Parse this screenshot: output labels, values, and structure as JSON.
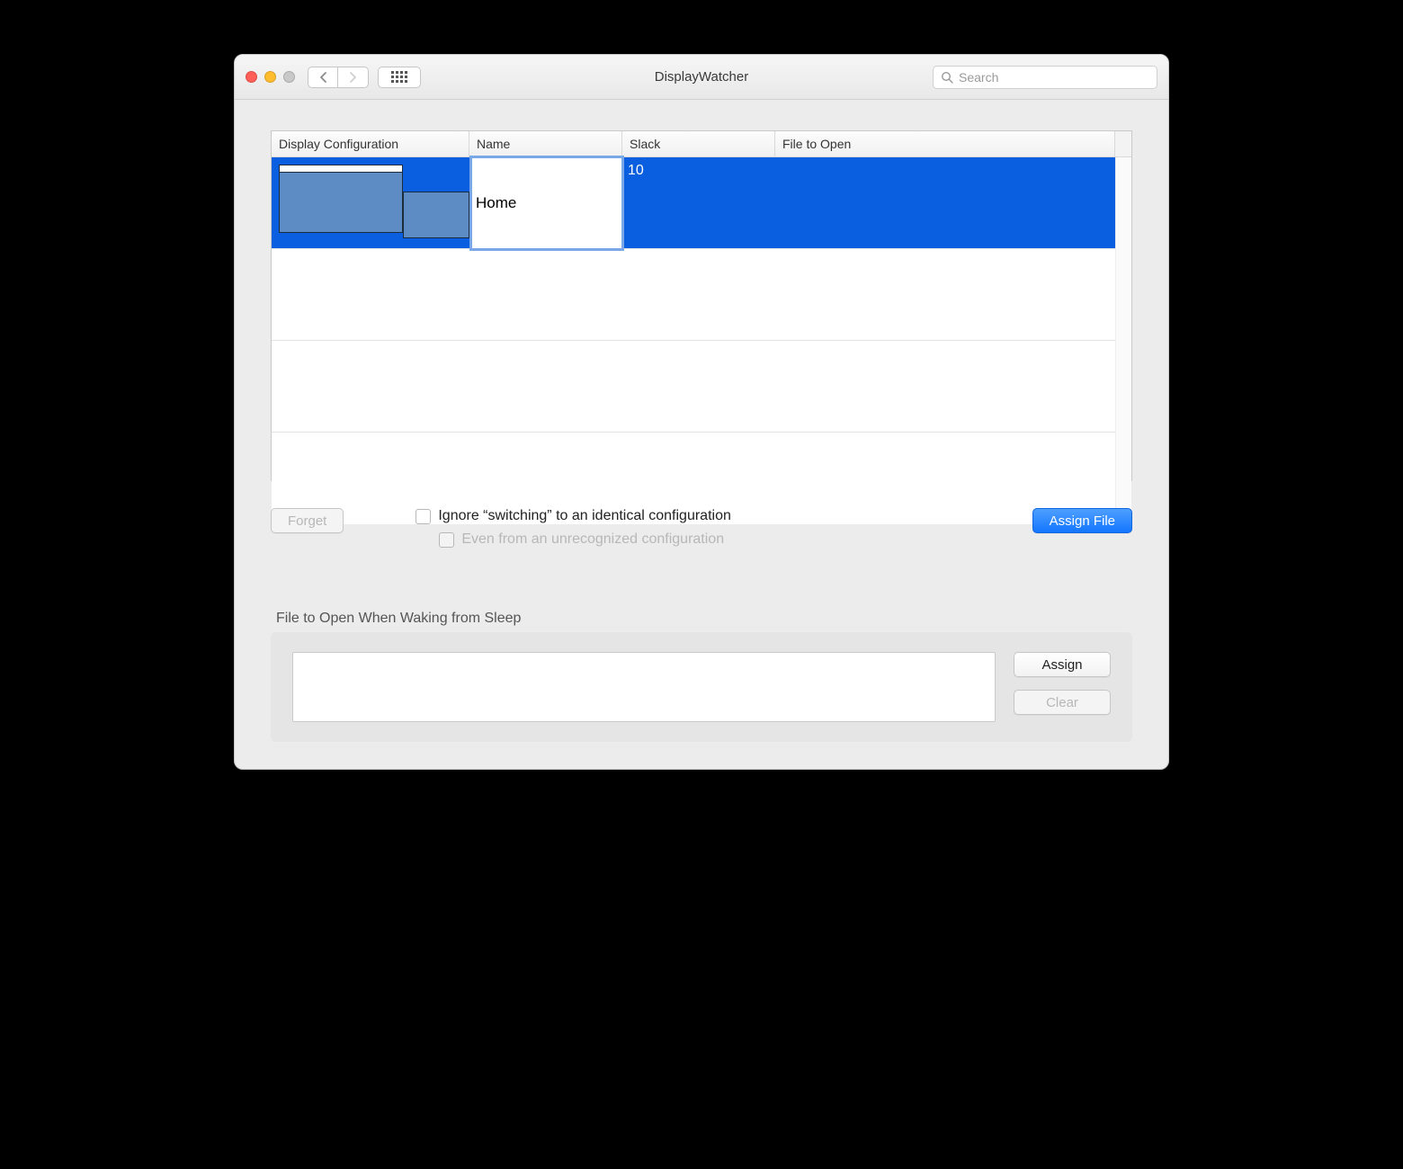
{
  "window": {
    "title": "DisplayWatcher"
  },
  "search": {
    "placeholder": "Search"
  },
  "table": {
    "headers": {
      "display_config": "Display Configuration",
      "name": "Name",
      "slack": "Slack",
      "file": "File to Open"
    },
    "rows": [
      {
        "name": "Home",
        "slack": "10",
        "file": ""
      }
    ]
  },
  "buttons": {
    "forget": "Forget",
    "assign_file": "Assign File",
    "wake_assign": "Assign",
    "wake_clear": "Clear"
  },
  "checkboxes": {
    "ignore_switch": "Ignore “switching” to an identical configuration",
    "even_unrecognized": "Even from an unrecognized configuration"
  },
  "wake": {
    "label": "File to Open When Waking from Sleep",
    "path": ""
  }
}
